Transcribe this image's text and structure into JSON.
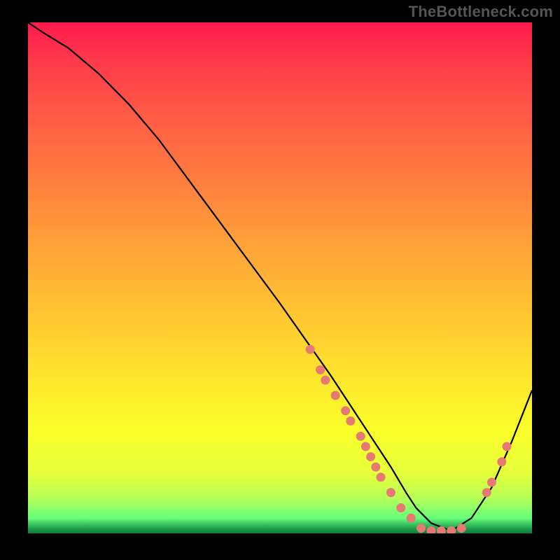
{
  "attribution": "TheBottleneck.com",
  "chart_data": {
    "type": "line",
    "title": "",
    "xlabel": "",
    "ylabel": "",
    "x_range": [
      0,
      100
    ],
    "y_range": [
      0,
      100
    ],
    "grid": false,
    "legend": false,
    "series": [
      {
        "name": "bottleneck-curve",
        "color": "#000000",
        "x": [
          0,
          3,
          8,
          14,
          20,
          26,
          32,
          38,
          44,
          50,
          55,
          60,
          64,
          68,
          72,
          75,
          77,
          80,
          84,
          88,
          92,
          96,
          100
        ],
        "y": [
          100,
          98,
          95,
          90,
          84,
          77,
          69,
          61,
          53,
          45,
          38,
          31,
          25,
          19,
          13,
          8,
          5,
          2,
          0.5,
          3,
          9,
          18,
          28
        ]
      }
    ],
    "markers": [
      {
        "x": 56,
        "y": 36,
        "color": "#e67a72"
      },
      {
        "x": 58,
        "y": 32,
        "color": "#e67a72"
      },
      {
        "x": 59,
        "y": 30,
        "color": "#e67a72"
      },
      {
        "x": 61,
        "y": 27,
        "color": "#e67a72"
      },
      {
        "x": 63,
        "y": 24,
        "color": "#e67a72"
      },
      {
        "x": 64,
        "y": 22,
        "color": "#e67a72"
      },
      {
        "x": 66,
        "y": 19,
        "color": "#e67a72"
      },
      {
        "x": 67,
        "y": 17,
        "color": "#e67a72"
      },
      {
        "x": 68,
        "y": 15,
        "color": "#e67a72"
      },
      {
        "x": 69,
        "y": 13,
        "color": "#e67a72"
      },
      {
        "x": 70,
        "y": 11,
        "color": "#e67a72"
      },
      {
        "x": 72,
        "y": 8,
        "color": "#e67a72"
      },
      {
        "x": 74,
        "y": 5,
        "color": "#e67a72"
      },
      {
        "x": 76,
        "y": 3,
        "color": "#e67a72"
      },
      {
        "x": 78,
        "y": 1,
        "color": "#e67a72"
      },
      {
        "x": 80,
        "y": 0.5,
        "color": "#e67a72"
      },
      {
        "x": 82,
        "y": 0.5,
        "color": "#e67a72"
      },
      {
        "x": 84,
        "y": 0.5,
        "color": "#e67a72"
      },
      {
        "x": 86,
        "y": 1,
        "color": "#e67a72"
      },
      {
        "x": 91,
        "y": 8,
        "color": "#e67a72"
      },
      {
        "x": 92,
        "y": 10,
        "color": "#e67a72"
      },
      {
        "x": 94,
        "y": 14,
        "color": "#e67a72"
      },
      {
        "x": 95,
        "y": 17,
        "color": "#e67a72"
      }
    ],
    "gradient_stops": [
      {
        "pos": 0,
        "color": "#ff1a4d"
      },
      {
        "pos": 18,
        "color": "#ff5a45"
      },
      {
        "pos": 42,
        "color": "#ff9e39"
      },
      {
        "pos": 68,
        "color": "#ffe22d"
      },
      {
        "pos": 88,
        "color": "#e6ff3a"
      },
      {
        "pos": 97,
        "color": "#66ff7a"
      },
      {
        "pos": 100,
        "color": "#0d7a3a"
      }
    ]
  }
}
